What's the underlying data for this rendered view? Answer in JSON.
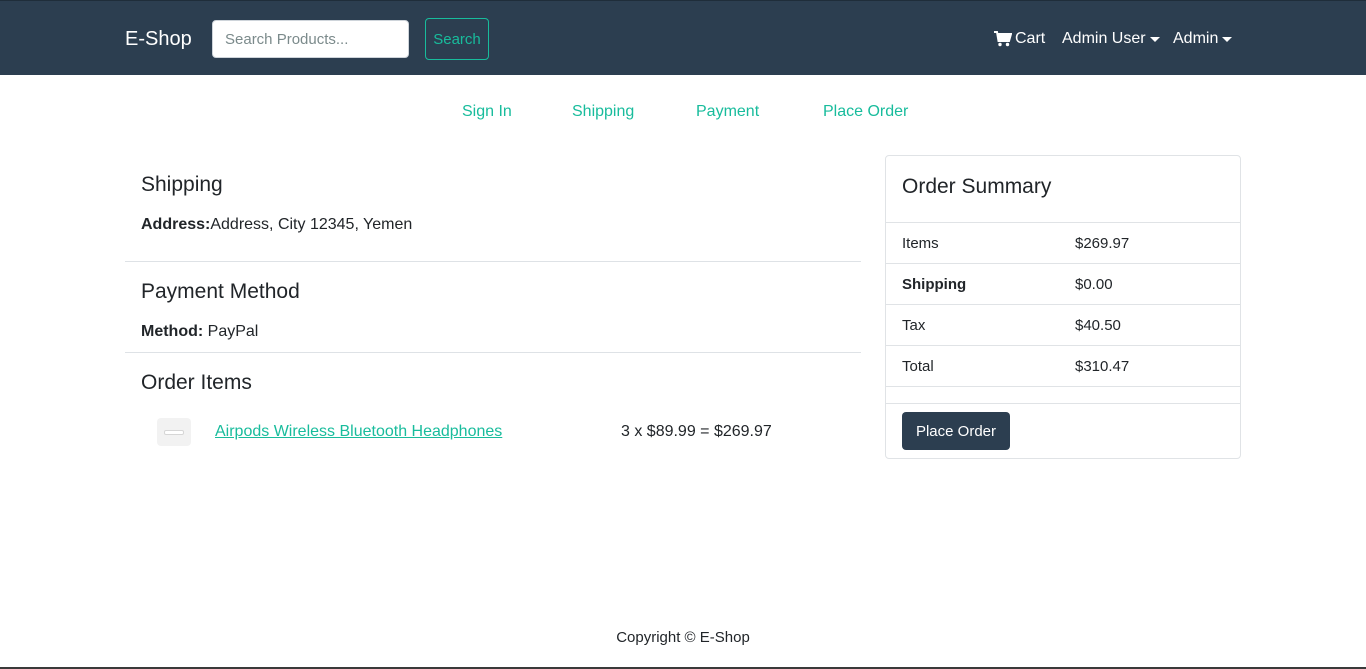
{
  "navbar": {
    "brand": "E-Shop",
    "search_placeholder": "Search Products...",
    "search_button": "Search",
    "cart_label": "Cart",
    "user_menu": "Admin User",
    "admin_menu": "Admin"
  },
  "steps": [
    "Sign In",
    "Shipping",
    "Payment",
    "Place Order"
  ],
  "shipping": {
    "title": "Shipping",
    "address_label": "Address:",
    "address_value": "Address, City 12345, Yemen"
  },
  "payment": {
    "title": "Payment Method",
    "method_label": "Method:",
    "method_value": "PayPal"
  },
  "order_items": {
    "title": "Order Items",
    "items": [
      {
        "name": "Airpods Wireless Bluetooth Headphones",
        "price_line": "3 x $89.99 = $269.97"
      }
    ]
  },
  "summary": {
    "title": "Order Summary",
    "rows": [
      {
        "label": "Items",
        "value": "$269.97"
      },
      {
        "label": "Shipping",
        "value": "$0.00"
      },
      {
        "label": "Tax",
        "value": "$40.50"
      },
      {
        "label": "Total",
        "value": "$310.47"
      }
    ],
    "place_order_button": "Place Order"
  },
  "footer": {
    "copyright": "Copyright © E-Shop"
  },
  "colors": {
    "navbar": "#2c3e50",
    "accent": "#18bc9c",
    "button": "#2c3e50"
  }
}
